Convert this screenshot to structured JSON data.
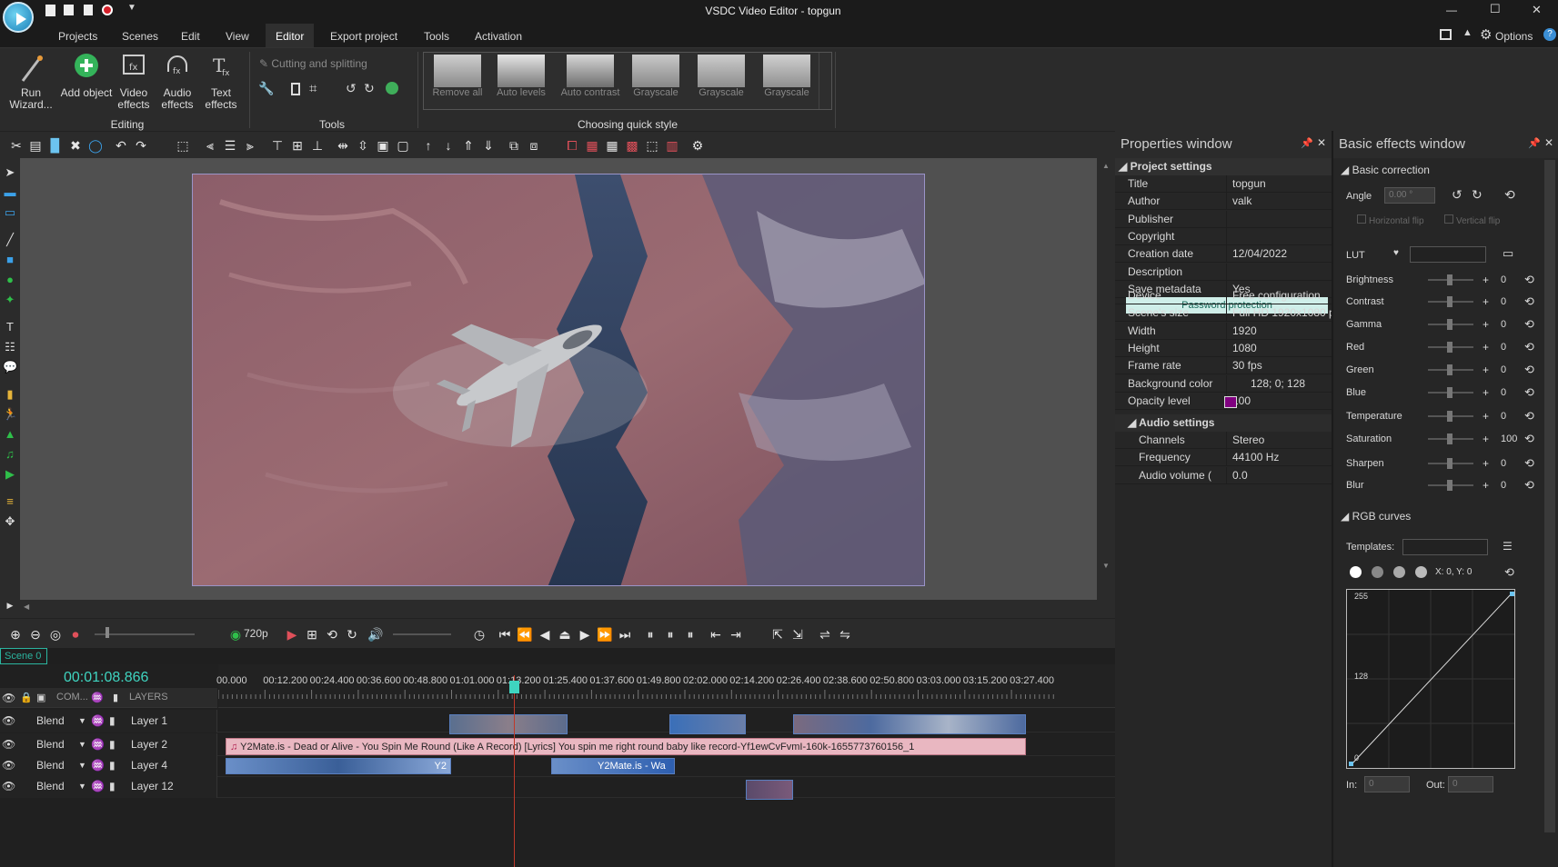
{
  "window": {
    "title": "VSDC Video Editor - topgun",
    "minimize": "—",
    "maximize": "☐",
    "close": "✕"
  },
  "menu": {
    "items": [
      "Projects",
      "Scenes",
      "Edit",
      "View",
      "Editor",
      "Export project",
      "Tools",
      "Activation"
    ],
    "active": "Editor",
    "options_label": "Options"
  },
  "ribbon": {
    "run_wizard": "Run Wizard...",
    "add_object": "Add object",
    "video_effects": "Video effects",
    "audio_effects": "Audio effects",
    "text_effects": "Text effects",
    "group_editing": "Editing",
    "cutting_splitting": "Cutting and splitting",
    "group_tools": "Tools",
    "styles": [
      "Remove all",
      "Auto levels",
      "Auto contrast",
      "Grayscale",
      "Grayscale",
      "Grayscale"
    ],
    "group_quick_style": "Choosing quick style"
  },
  "properties": {
    "header": "Properties window",
    "project_settings": "Project settings",
    "rows": [
      {
        "k": "Title",
        "v": "topgun"
      },
      {
        "k": "Author",
        "v": "valk"
      },
      {
        "k": "Publisher",
        "v": ""
      },
      {
        "k": "Copyright",
        "v": ""
      },
      {
        "k": "Creation date",
        "v": "12/04/2022"
      },
      {
        "k": "Description",
        "v": ""
      },
      {
        "k": "Save metadata",
        "v": "Yes"
      }
    ],
    "password_button": "Password protection",
    "rows2": [
      {
        "k": "Device",
        "v": "Free configuration"
      },
      {
        "k": "Scene's size",
        "v": "Full HD 1920x1080 pix"
      },
      {
        "k": "Width",
        "v": "1920"
      },
      {
        "k": "Height",
        "v": "1080"
      },
      {
        "k": "Frame rate",
        "v": "30 fps"
      },
      {
        "k": "Background color",
        "v": "128; 0; 128"
      },
      {
        "k": "Opacity level",
        "v": "100"
      }
    ],
    "background_color_swatch": "#800080",
    "audio_settings": "Audio settings",
    "rows3": [
      {
        "k": "Channels",
        "v": "Stereo"
      },
      {
        "k": "Frequency",
        "v": "44100 Hz"
      },
      {
        "k": "Audio volume (",
        "v": "0.0"
      }
    ]
  },
  "effects": {
    "header": "Basic effects window",
    "basic_correction": "Basic correction",
    "angle_label": "Angle",
    "angle_value": "0.00 °",
    "hflip": "Horizontal flip",
    "vflip": "Vertical flip",
    "lut_label": "LUT",
    "sliders": [
      {
        "label": "Brightness",
        "value": "0"
      },
      {
        "label": "Contrast",
        "value": "0"
      },
      {
        "label": "Gamma",
        "value": "0"
      },
      {
        "label": "Red",
        "value": "0"
      },
      {
        "label": "Green",
        "value": "0"
      },
      {
        "label": "Blue",
        "value": "0"
      },
      {
        "label": "Temperature",
        "value": "0"
      },
      {
        "label": "Saturation",
        "value": "100"
      },
      {
        "label": "Sharpen",
        "value": "0"
      },
      {
        "label": "Blur",
        "value": "0"
      }
    ],
    "rgb_curves": "RGB curves",
    "templates_label": "Templates:",
    "xy_readout": "X: 0, Y: 0",
    "curve_max": "255",
    "curve_mid": "128",
    "curve_min": "0",
    "in_label": "In:",
    "in_value": "0",
    "out_label": "Out:",
    "out_value": "0"
  },
  "playback": {
    "resolution": "720p"
  },
  "timeline": {
    "scene_tab": "Scene 0",
    "timecode": "00:01:08.866",
    "com_label": "COM...",
    "layers_label": "LAYERS",
    "ruler": [
      "00.000",
      "00:12.200",
      "00:24.400",
      "00:36.600",
      "00:48.800",
      "01:01.000",
      "01:13.200",
      "01:25.400",
      "01:37.600",
      "01:49.800",
      "02:02.000",
      "02:14.200",
      "02:26.400",
      "02:38.600",
      "02:50.800",
      "03:03.000",
      "03:15.200",
      "03:27.400"
    ],
    "tracks": [
      {
        "blend": "Blend",
        "name": "Layer 1"
      },
      {
        "blend": "Blend",
        "name": "Layer 2"
      },
      {
        "blend": "Blend",
        "name": "Layer 4"
      },
      {
        "blend": "Blend",
        "name": "Layer 12"
      }
    ],
    "audio_clip": "Y2Mate.is - Dead or Alive - You Spin Me Round (Like A Record) [Lyrics] You spin me right round baby like record-Yf1ewCvFvmI-160k-1655773760156_1",
    "clip_y2a": "Y2",
    "clip_y2b": "Y2Mate.is - Wa"
  }
}
